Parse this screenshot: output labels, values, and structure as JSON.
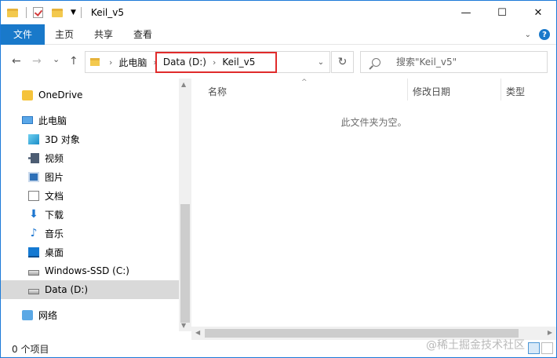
{
  "window": {
    "title": "Keil_v5"
  },
  "title_controls": {
    "minimize": "—",
    "maximize": "☐",
    "close": "✕"
  },
  "ribbon": {
    "tabs": [
      "文件",
      "主页",
      "共享",
      "查看"
    ]
  },
  "nav": {
    "back": "←",
    "forward": "→",
    "recent": "⌄",
    "up": "↑"
  },
  "address": {
    "crumbs": [
      "此电脑",
      "Data (D:)",
      "Keil_v5"
    ]
  },
  "search": {
    "placeholder": "搜索\"Keil_v5\""
  },
  "sidebar": {
    "items": [
      {
        "label": "OneDrive",
        "icon": "onedrive-icon"
      },
      {
        "label": "此电脑",
        "icon": "pc-icon"
      },
      {
        "label": "3D 对象",
        "icon": "3d-objects-icon"
      },
      {
        "label": "视频",
        "icon": "video-icon"
      },
      {
        "label": "图片",
        "icon": "pictures-icon"
      },
      {
        "label": "文档",
        "icon": "documents-icon"
      },
      {
        "label": "下载",
        "icon": "downloads-icon"
      },
      {
        "label": "音乐",
        "icon": "music-icon"
      },
      {
        "label": "桌面",
        "icon": "desktop-icon"
      },
      {
        "label": "Windows-SSD (C:)",
        "icon": "drive-icon"
      },
      {
        "label": "Data (D:)",
        "icon": "drive-icon",
        "selected": true
      },
      {
        "label": "网络",
        "icon": "network-icon"
      }
    ]
  },
  "list": {
    "columns": [
      "名称",
      "修改日期",
      "类型"
    ],
    "empty_message": "此文件夹为空。"
  },
  "status": {
    "item_count": "0 个项目"
  },
  "watermark": "@稀土掘金技术社区",
  "colors": {
    "accent": "#1979ca",
    "highlight": "#e02b2b"
  }
}
